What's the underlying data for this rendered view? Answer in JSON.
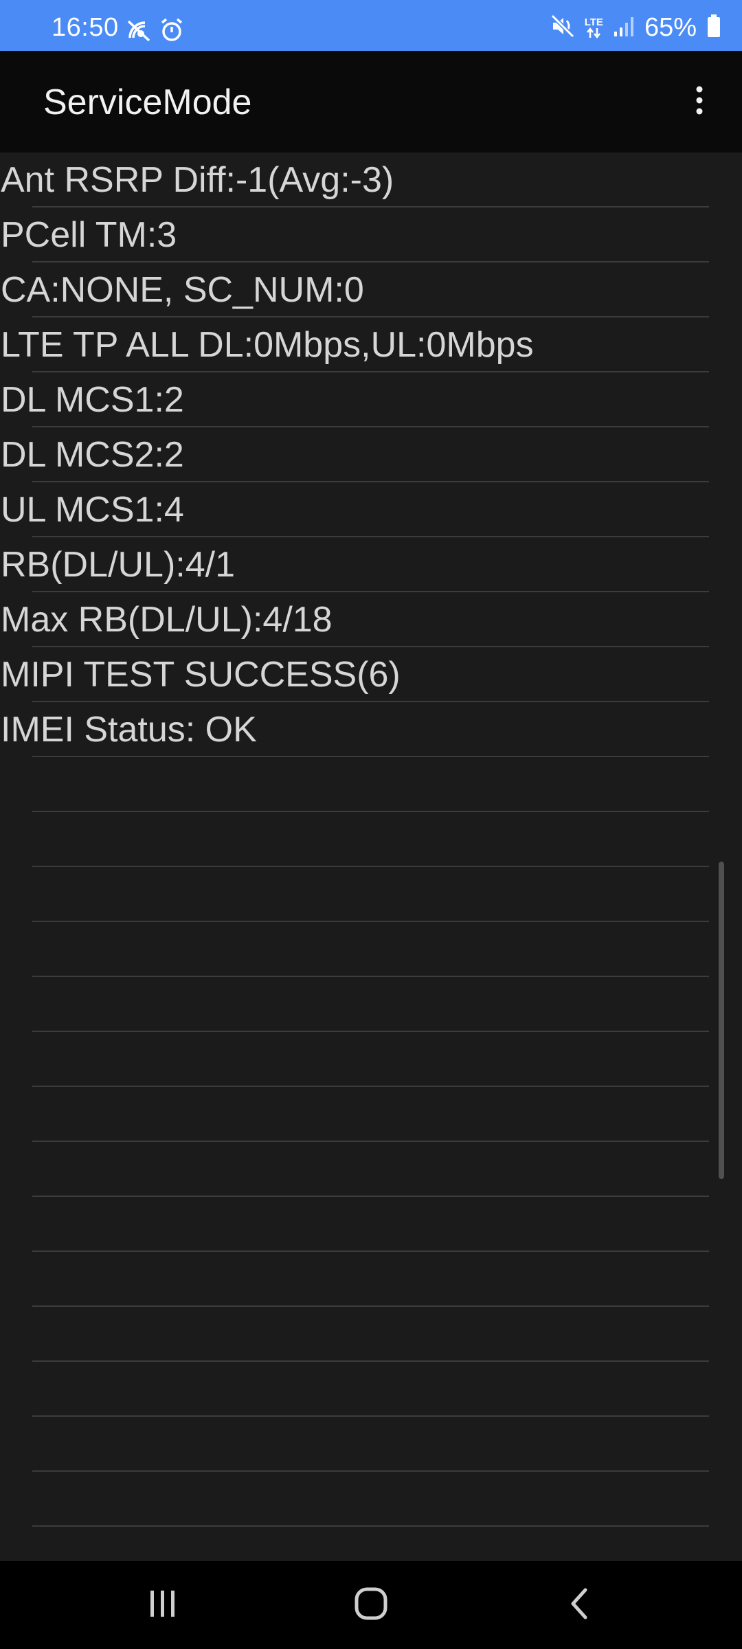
{
  "status_bar": {
    "time": "16:50",
    "battery_percent": "65%",
    "network_type": "LTE",
    "left_icons": [
      "signal-off-icon",
      "alarm-icon"
    ],
    "right_icons": [
      "mute-icon",
      "lte-data-icon",
      "cell-signal-icon",
      "battery-icon"
    ]
  },
  "app_bar": {
    "title": "ServiceMode",
    "overflow_icon": "more-vert-icon"
  },
  "rows": [
    "Ant RSRP Diff:-1(Avg:-3)",
    "PCell TM:3",
    "CA:NONE, SC_NUM:0",
    "LTE TP ALL DL:0Mbps,UL:0Mbps",
    "DL MCS1:2",
    "DL MCS2:2",
    "UL MCS1:4",
    "RB(DL/UL):4/1",
    "Max RB(DL/UL):4/18",
    "MIPI TEST SUCCESS(6)",
    "IMEI Status: OK",
    "",
    "",
    "",
    "",
    "",
    "",
    "",
    "",
    "",
    "",
    "",
    "",
    "",
    "",
    ""
  ],
  "nav_bar": {
    "buttons": [
      "recent-apps-icon",
      "home-icon",
      "back-icon"
    ]
  },
  "colors": {
    "status_bar": "#4a8bf5",
    "app_bar": "#0a0a0a",
    "content_bg": "#1b1b1b",
    "text": "#d6d6d6",
    "divider": "#3c3c3c"
  }
}
